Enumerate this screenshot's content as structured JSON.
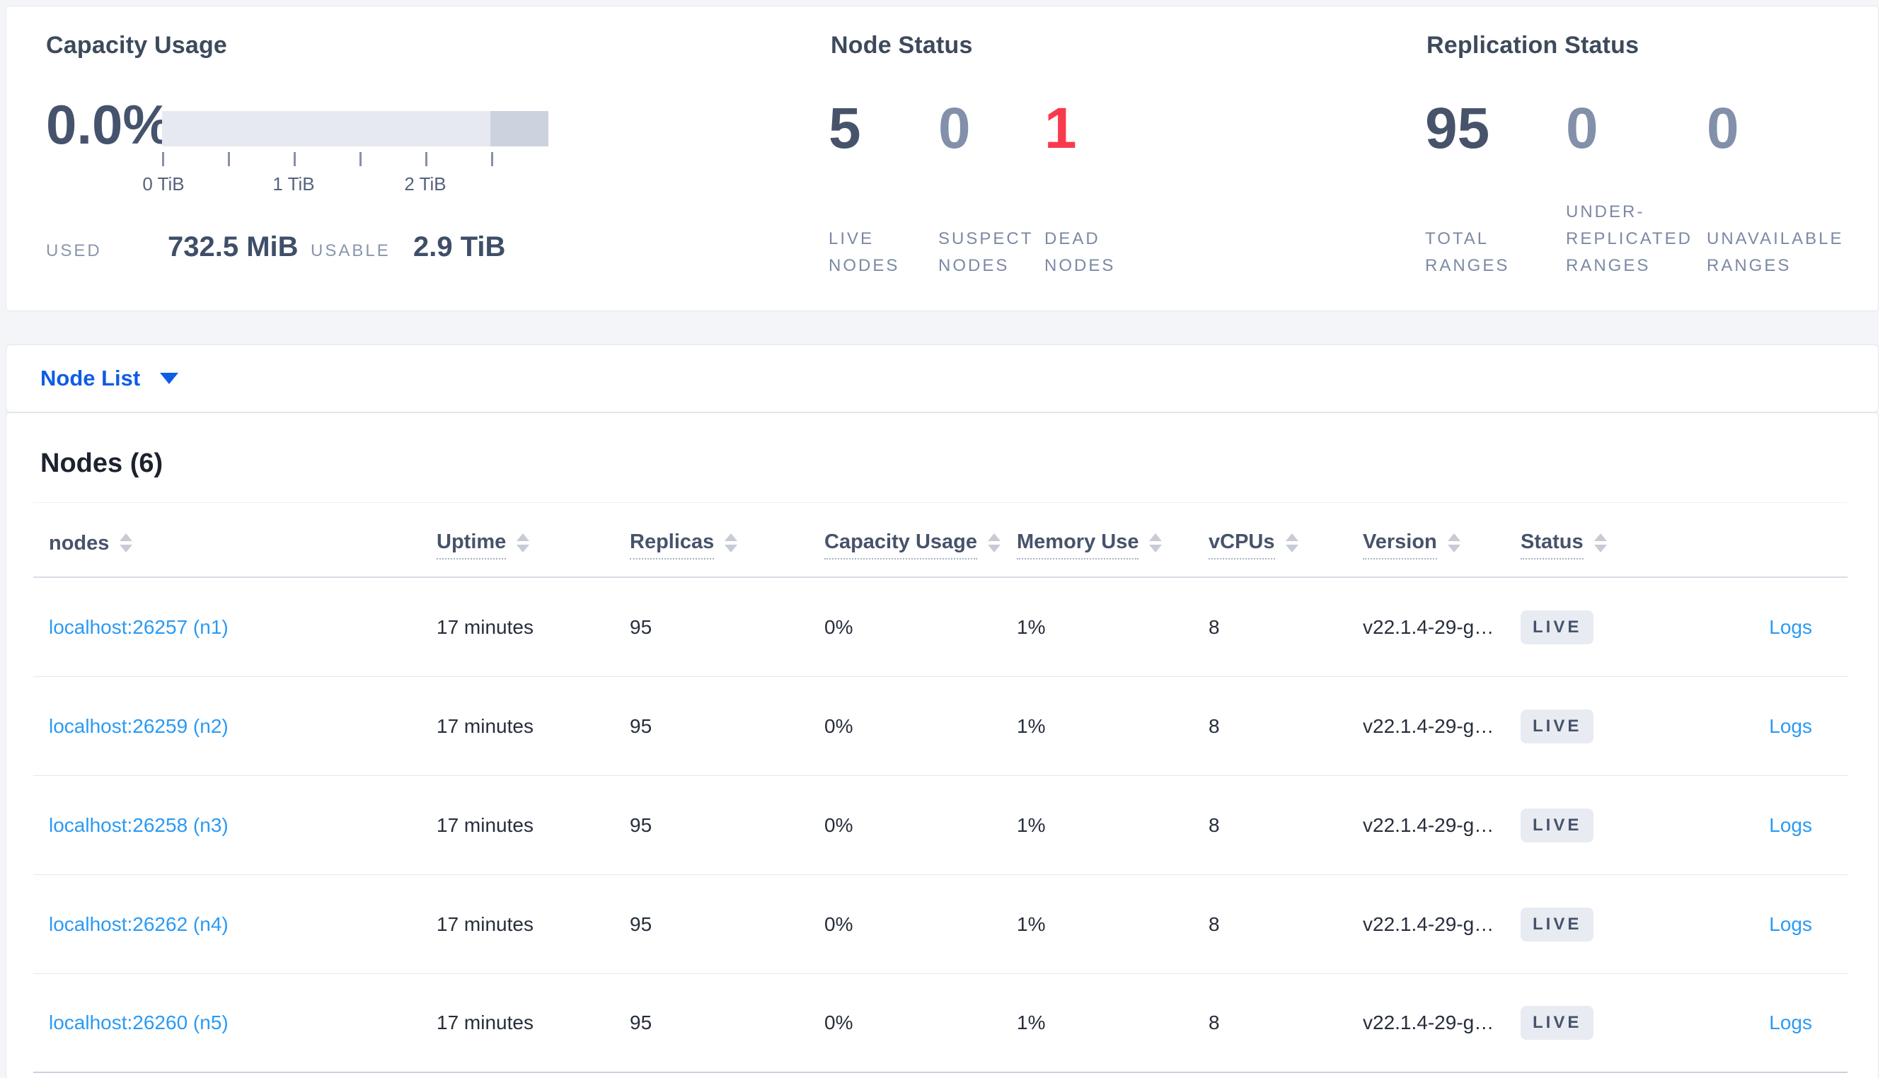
{
  "colors": {
    "accent_blue": "#0f5ce5",
    "link_blue": "#2b9af3",
    "dead_red": "#fb394d",
    "bar_light": "#e7e9f1",
    "bar_dark": "#cdd2df",
    "badge_bg": "#e8ecf2"
  },
  "summary": {
    "capacity": {
      "title": "Capacity Usage",
      "percent": "0.0%",
      "ticks": [
        "0 TiB",
        "1 TiB",
        "2 TiB"
      ],
      "used_label": "USED",
      "used_value": "732.5 MiB",
      "usable_label": "USABLE",
      "usable_value": "2.9 TiB"
    },
    "node_status": {
      "title": "Node Status",
      "stats": [
        {
          "value": "5",
          "label": "LIVE NODES"
        },
        {
          "value": "0",
          "label": "SUSPECT NODES"
        },
        {
          "value": "1",
          "label": "DEAD NODES"
        }
      ]
    },
    "replication_status": {
      "title": "Replication Status",
      "stats": [
        {
          "value": "95",
          "label": "TOTAL RANGES"
        },
        {
          "value": "0",
          "label": "UNDER-REPLICATED RANGES"
        },
        {
          "value": "0",
          "label": "UNAVAILABLE RANGES"
        }
      ]
    }
  },
  "view_selector": {
    "label": "Node List"
  },
  "nodes_section": {
    "title": "Nodes (6)",
    "columns": [
      {
        "label": "nodes"
      },
      {
        "label": "Uptime"
      },
      {
        "label": "Replicas"
      },
      {
        "label": "Capacity Usage"
      },
      {
        "label": "Memory Use"
      },
      {
        "label": "vCPUs"
      },
      {
        "label": "Version"
      },
      {
        "label": "Status"
      }
    ],
    "rows": [
      {
        "name": "localhost:26257 (n1)",
        "uptime": "17 minutes",
        "replicas": "95",
        "capacity_usage": "0%",
        "memory_use": "1%",
        "vcpus": "8",
        "version": "v22.1.4-29-g…",
        "status": "LIVE",
        "logs": "Logs"
      },
      {
        "name": "localhost:26259 (n2)",
        "uptime": "17 minutes",
        "replicas": "95",
        "capacity_usage": "0%",
        "memory_use": "1%",
        "vcpus": "8",
        "version": "v22.1.4-29-g…",
        "status": "LIVE",
        "logs": "Logs"
      },
      {
        "name": "localhost:26258 (n3)",
        "uptime": "17 minutes",
        "replicas": "95",
        "capacity_usage": "0%",
        "memory_use": "1%",
        "vcpus": "8",
        "version": "v22.1.4-29-g…",
        "status": "LIVE",
        "logs": "Logs"
      },
      {
        "name": "localhost:26262 (n4)",
        "uptime": "17 minutes",
        "replicas": "95",
        "capacity_usage": "0%",
        "memory_use": "1%",
        "vcpus": "8",
        "version": "v22.1.4-29-g…",
        "status": "LIVE",
        "logs": "Logs"
      },
      {
        "name": "localhost:26260 (n5)",
        "uptime": "17 minutes",
        "replicas": "95",
        "capacity_usage": "0%",
        "memory_use": "1%",
        "vcpus": "8",
        "version": "v22.1.4-29-g…",
        "status": "LIVE",
        "logs": "Logs"
      }
    ]
  }
}
